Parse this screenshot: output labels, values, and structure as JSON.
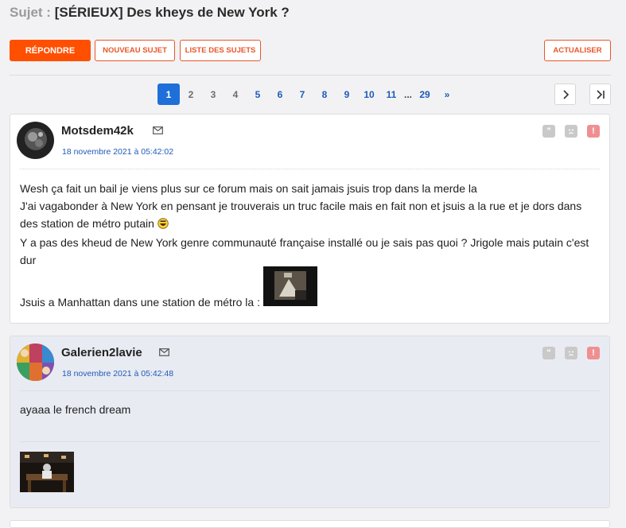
{
  "topic": {
    "prefix": "Sujet :",
    "title": "[SÉRIEUX] Des kheys de New York ?"
  },
  "toolbar": {
    "reply": "RÉPONDRE",
    "new_topic": "NOUVEAU SUJET",
    "topic_list": "LISTE DES SUJETS",
    "refresh": "ACTUALISER"
  },
  "pagination": {
    "pages": [
      "1",
      "2",
      "3",
      "4",
      "5",
      "6",
      "7",
      "8",
      "9",
      "10",
      "11"
    ],
    "current": "1",
    "ellipsis": "...",
    "last": "29",
    "next_glyph": "»"
  },
  "posts": [
    {
      "author": "Motsdem42k",
      "date": "18 novembre 2021 à 05:42:02",
      "lines": [
        "Wesh ça fait un bail je viens plus sur ce forum mais on sait jamais jsuis trop dans la merde la",
        "J'ai vagabonder à New York en pensant je trouverais un truc facile mais en fait non et jsuis a la rue et je dors dans des station de métro putain",
        "Y a pas des kheud de New York genre communauté française installé ou je sais pas quoi ? Jrigole mais putain c'est dur",
        "Jsuis a Manhattan dans une station de métro la :"
      ]
    },
    {
      "author": "Galerien2lavie",
      "date": "18 novembre 2021 à 05:42:48",
      "lines": [
        "ayaaa le french dream"
      ]
    }
  ],
  "colors": {
    "accent": "#ff4f00",
    "link": "#1e5bb8",
    "active_page": "#1e6fd9"
  }
}
